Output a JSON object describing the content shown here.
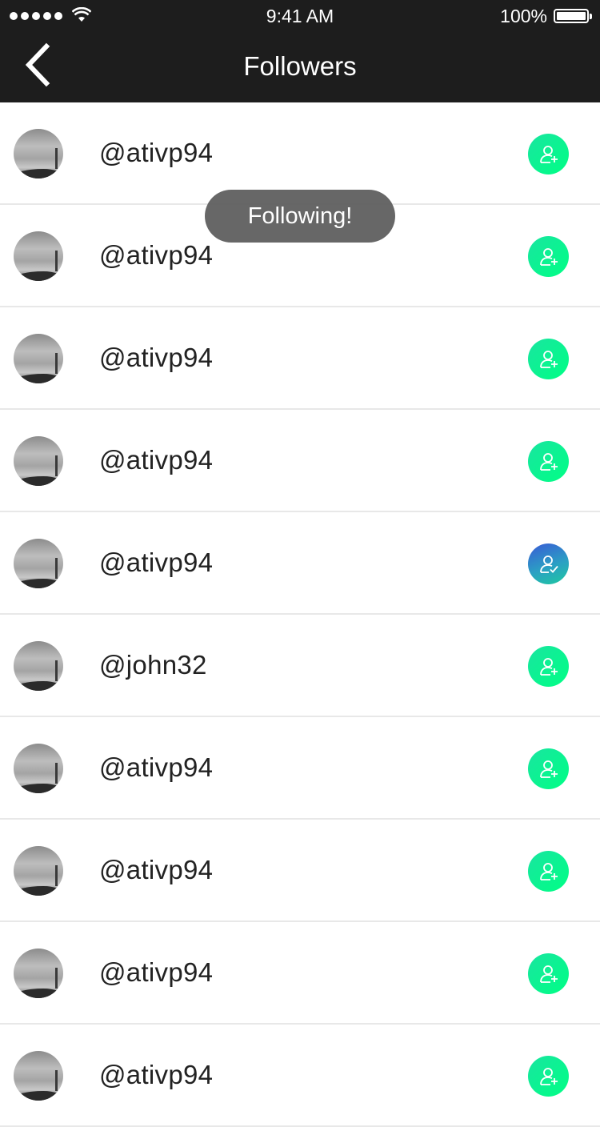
{
  "status_bar": {
    "time": "9:41 AM",
    "battery": "100%",
    "signal_icon": "signal-dots-icon",
    "wifi_icon": "wifi-icon"
  },
  "nav": {
    "title": "Followers",
    "back_icon": "chevron-left-icon"
  },
  "toast": "Following!",
  "colors": {
    "header_bg": "#1d1d1d",
    "follow_green": "#00ff85",
    "following_blue": "#3a5ad6"
  },
  "followers": [
    {
      "username": "@ativp94",
      "state": "follow",
      "icon": "add-user-icon"
    },
    {
      "username": "@ativp94",
      "state": "follow",
      "icon": "add-user-icon"
    },
    {
      "username": "@ativp94",
      "state": "follow",
      "icon": "add-user-icon"
    },
    {
      "username": "@ativp94",
      "state": "follow",
      "icon": "add-user-icon"
    },
    {
      "username": "@ativp94",
      "state": "following",
      "icon": "user-check-icon"
    },
    {
      "username": "@john32",
      "state": "follow",
      "icon": "add-user-icon"
    },
    {
      "username": "@ativp94",
      "state": "follow",
      "icon": "add-user-icon"
    },
    {
      "username": "@ativp94",
      "state": "follow",
      "icon": "add-user-icon"
    },
    {
      "username": "@ativp94",
      "state": "follow",
      "icon": "add-user-icon"
    },
    {
      "username": "@ativp94",
      "state": "follow",
      "icon": "add-user-icon"
    }
  ]
}
